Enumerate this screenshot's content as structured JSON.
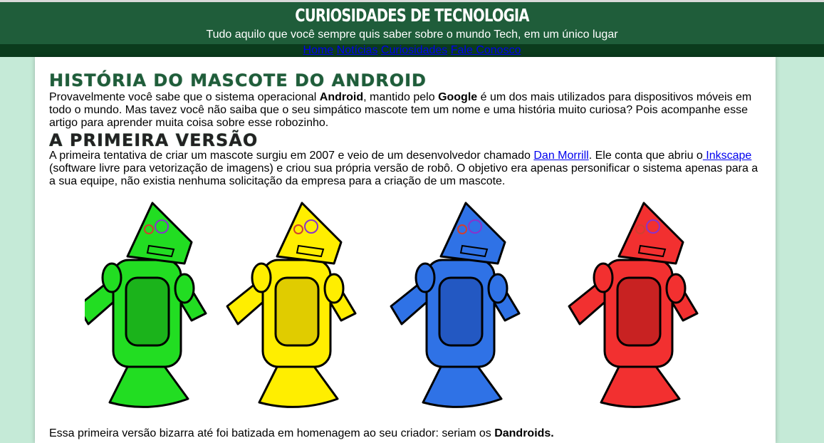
{
  "header": {
    "title": "CURIOSIDADES DE TECNOLOGIA",
    "subtitle": "Tudo aquilo que você sempre quis saber sobre o mundo Tech, em um único lugar"
  },
  "nav": {
    "items": [
      "Home",
      "Notícias",
      "Curiosidades",
      "Fale Conosco"
    ]
  },
  "article": {
    "title": "HISTÓRIA DO MASCOTE DO ANDROID",
    "intro": {
      "t1": "Provavelmente você sabe que o sistema operacional ",
      "b1": "Android",
      "t2": ", mantido pelo ",
      "b2": "Google",
      "t3": " é um dos mais utilizados para dispositivos móveis em todo o mundo. Mas tavez você não saiba que o seu simpático mascote tem um nome e uma história muito curiosa? Pois acompanhe esse artigo para aprender muita coisa sobre esse robozinho."
    },
    "section_title": "A PRIMEIRA VERSÃO",
    "section": {
      "t1": "A primeira tentativa de criar um mascote surgiu em 2007 e veio de um desenvolvedor chamado ",
      "link1": "Dan Morrill",
      "t2": ". Ele conta que abriu o",
      "link2": " Inkscape",
      "t3": " (software livre para vetorização de imagens) e criou sua própria versão de robô. O objetivo era apenas personificar o sistema apenas para a a sua equipe, não existia nenhuma solicitação da empresa para a criação de um mascote."
    },
    "closing": {
      "t1": "Essa primeira versão bizarra até foi batizada em homenagem ao seu criador: seriam os ",
      "b1": "Dandroids."
    }
  },
  "robots": [
    {
      "color": "#22dd22",
      "dark": "#1bb31b"
    },
    {
      "color": "#ffee00",
      "dark": "#e0cc00"
    },
    {
      "color": "#2f72e6",
      "dark": "#2358c2"
    },
    {
      "color": "#f23030",
      "dark": "#c82222"
    }
  ],
  "colors": {
    "header_bg": "#1f5d3a",
    "nav_bg": "#0b3b1d",
    "page_bg": "#c5ead7",
    "link": "#0000ee"
  }
}
